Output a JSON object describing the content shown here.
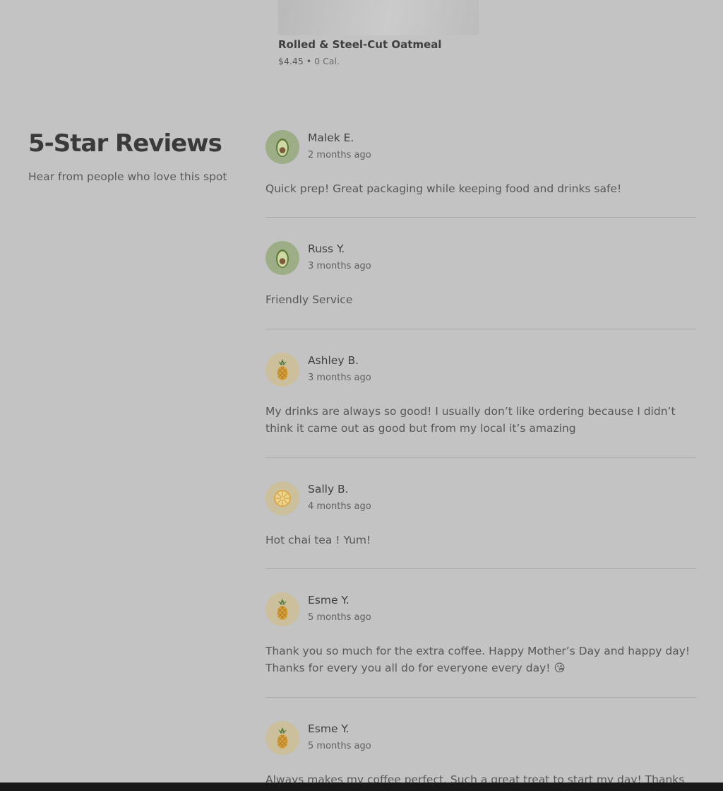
{
  "menu_item": {
    "name": "Rolled & Steel-Cut Oatmeal",
    "price": "$4.45",
    "separator": "•",
    "calories": "0 Cal."
  },
  "reviews_section": {
    "title": "5-Star Reviews",
    "subtitle": "Hear from people who love this spot",
    "reviews": [
      {
        "name": "Malek E.",
        "ago": "2 months ago",
        "text": "Quick prep! Great packaging while keeping food and drinks safe!",
        "avatar": "avocado-icon"
      },
      {
        "name": "Russ Y.",
        "ago": "3 months ago",
        "text": "Friendly Service",
        "avatar": "avocado-icon"
      },
      {
        "name": "Ashley B.",
        "ago": "3 months ago",
        "text": "My drinks are always so good! I usually don’t like ordering because I didn’t think it came out as good but from my local it’s amazing",
        "avatar": "pineapple-icon"
      },
      {
        "name": "Sally B.",
        "ago": "4 months ago",
        "text": "Hot chai tea ! Yum!",
        "avatar": "lemon-slice-icon"
      },
      {
        "name": "Esme Y.",
        "ago": "5 months ago",
        "text": "Thank you so much for the extra coffee. Happy Mother’s Day and happy day! Thanks for every you all do for everyone every day! 😘",
        "avatar": "pineapple-icon"
      },
      {
        "name": "Esme Y.",
        "ago": "5 months ago",
        "text": "Always makes my coffee perfect. Such a great treat to start my day! Thanks",
        "avatar": "pineapple-icon"
      }
    ]
  },
  "colors": {
    "overlay_background": "#c3c3c3",
    "avocado_avatar_bg": "#9dae86",
    "pineapple_avatar_bg": "#cbbf9c"
  }
}
